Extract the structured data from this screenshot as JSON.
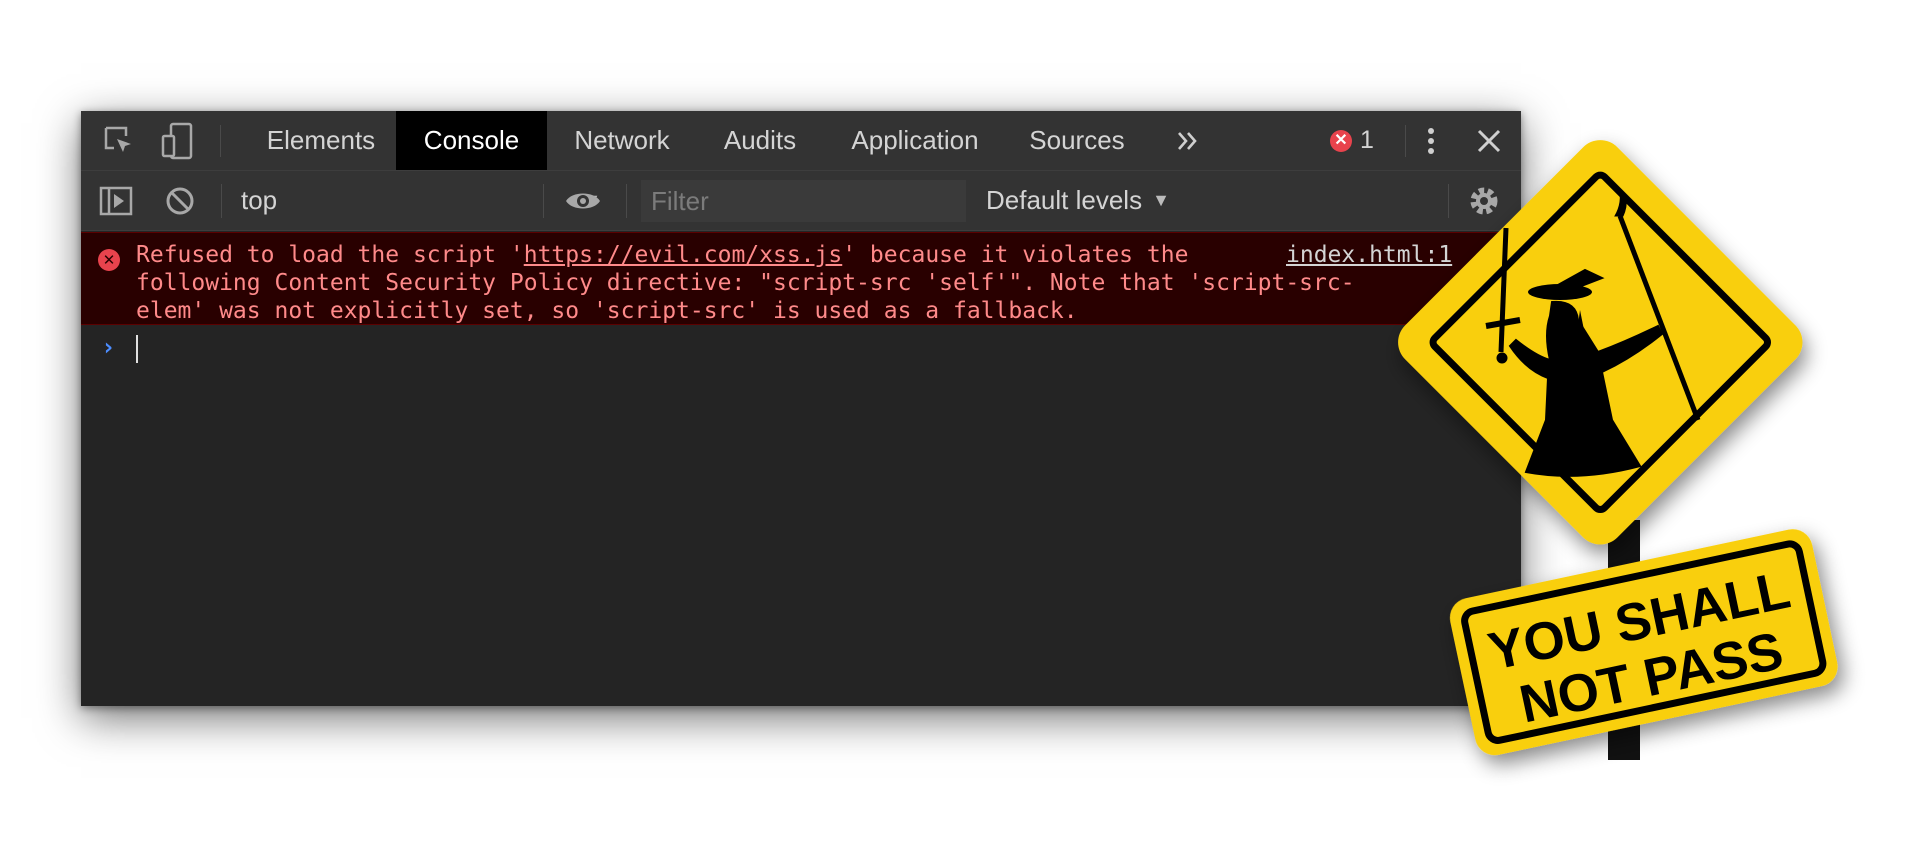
{
  "tabs": [
    {
      "label": "Elements",
      "active": false
    },
    {
      "label": "Console",
      "active": true
    },
    {
      "label": "Network",
      "active": false
    },
    {
      "label": "Audits",
      "active": false
    },
    {
      "label": "Application",
      "active": false
    },
    {
      "label": "Sources",
      "active": false
    }
  ],
  "tabbar": {
    "error_count": "1",
    "icons": [
      "inspect-element-icon",
      "device-toolbar-icon",
      "more-tabs-icon",
      "error-icon",
      "kebab-menu-icon",
      "close-icon"
    ]
  },
  "toolbar": {
    "context": "top",
    "filter_placeholder": "Filter",
    "filter_value": "",
    "levels": "Default levels",
    "icons": [
      "show-sidebar-icon",
      "clear-console-icon",
      "dropdown-arrow-icon",
      "live-expression-eye-icon",
      "settings-gear-icon"
    ]
  },
  "console": {
    "error": {
      "prefix": "Refused to load the script '",
      "url": "https://evil.com/xss.js",
      "line1_rest": "' because it violates the",
      "line2": "following Content Security Policy directive: \"script-src 'self'\". Note that 'script-src-",
      "line3": "elem' was not explicitly set, so 'script-src' is used as a fallback.",
      "source": "index.html:1"
    }
  },
  "sign": {
    "line1": "YOU SHALL",
    "line2": "NOT PASS",
    "colors": {
      "yellow": "#f9cf0d",
      "black": "#000000"
    }
  },
  "colors": {
    "panel_bg": "#242424",
    "bar_bg": "#333333",
    "error_bg": "#290000",
    "error_text": "#ff8a8a",
    "prompt_blue": "#4c8dff"
  }
}
